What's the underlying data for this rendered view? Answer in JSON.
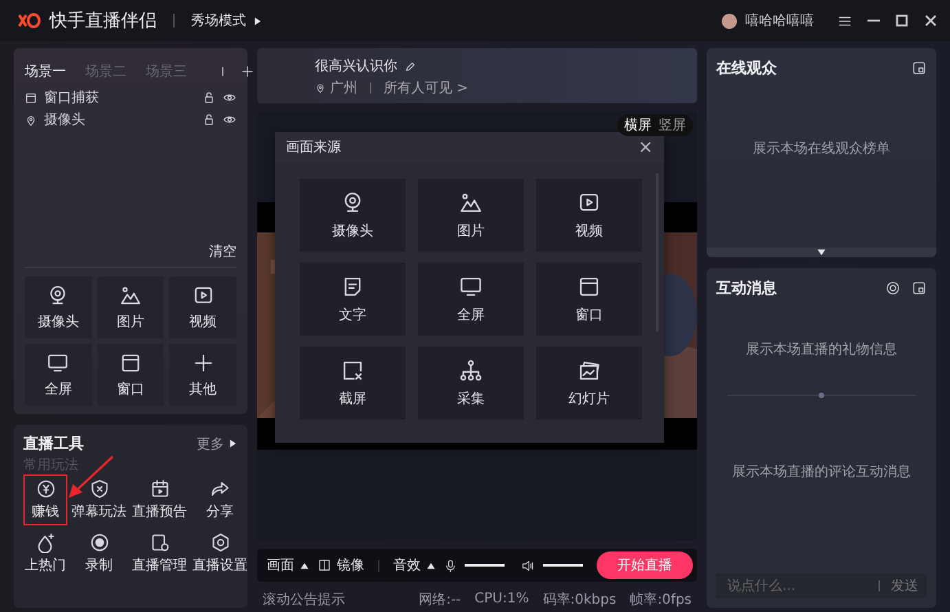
{
  "app": {
    "title": "快手直播伴侣",
    "mode": "秀场模式",
    "mode_expanded": false,
    "username": "嘻哈哈嘻嘻"
  },
  "scenes": {
    "tabs": [
      {
        "label": "场景一",
        "selected": true
      },
      {
        "label": "场景二",
        "selected": false
      },
      {
        "label": "场景三",
        "selected": false
      }
    ],
    "sources": [
      {
        "label": "窗口捕获"
      },
      {
        "label": "摄像头"
      }
    ],
    "clear": "清空",
    "add_buttons": [
      {
        "label": "摄像头"
      },
      {
        "label": "图片"
      },
      {
        "label": "视频"
      },
      {
        "label": "全屏"
      },
      {
        "label": "窗口"
      },
      {
        "label": "其他"
      }
    ]
  },
  "tools": {
    "title": "直播工具",
    "more": "更多",
    "section": "常用玩法",
    "items": [
      {
        "label": "赚钱",
        "highlighted": true
      },
      {
        "label": "弹幕玩法",
        "highlighted": false
      },
      {
        "label": "直播预告",
        "highlighted": false
      },
      {
        "label": "分享",
        "highlighted": false
      },
      {
        "label": "上热门",
        "highlighted": false
      },
      {
        "label": "录制",
        "highlighted": false
      },
      {
        "label": "直播管理",
        "highlighted": false
      },
      {
        "label": "直播设置",
        "highlighted": false
      }
    ]
  },
  "stream": {
    "title": "很高兴认识你",
    "location": "广州",
    "visibility": "所有人可见 >"
  },
  "orientation": [
    {
      "label": "横屏",
      "selected": true
    },
    {
      "label": "竖屏",
      "selected": false
    }
  ],
  "dialog": {
    "title": "画面来源",
    "close": "×",
    "items": [
      {
        "label": "摄像头"
      },
      {
        "label": "图片"
      },
      {
        "label": "视频"
      },
      {
        "label": "文字"
      },
      {
        "label": "全屏"
      },
      {
        "label": "窗口"
      },
      {
        "label": "截屏"
      },
      {
        "label": "采集"
      },
      {
        "label": "幻灯片"
      }
    ]
  },
  "controls": {
    "picture": "画面",
    "mirror": "镜像",
    "effects": "音效",
    "mic": {
      "level": 1
    },
    "speaker": {
      "level": 1
    },
    "start": "开始直播"
  },
  "status": {
    "notice": "滚动公告提示",
    "network": "网络:--",
    "cpu": "CPU:1%",
    "bitrate": "码率:0kbps",
    "fps": "帧率:0fps"
  },
  "audience": {
    "title": "在线观众",
    "empty": "展示本场在线观众榜单"
  },
  "messages": {
    "title": "互动消息",
    "gifts_empty": "展示本场直播的礼物信息",
    "comments_empty": "展示本场直播的评论互动消息",
    "input": {
      "placeholder": "说点什么..."
    },
    "send": "发送"
  }
}
